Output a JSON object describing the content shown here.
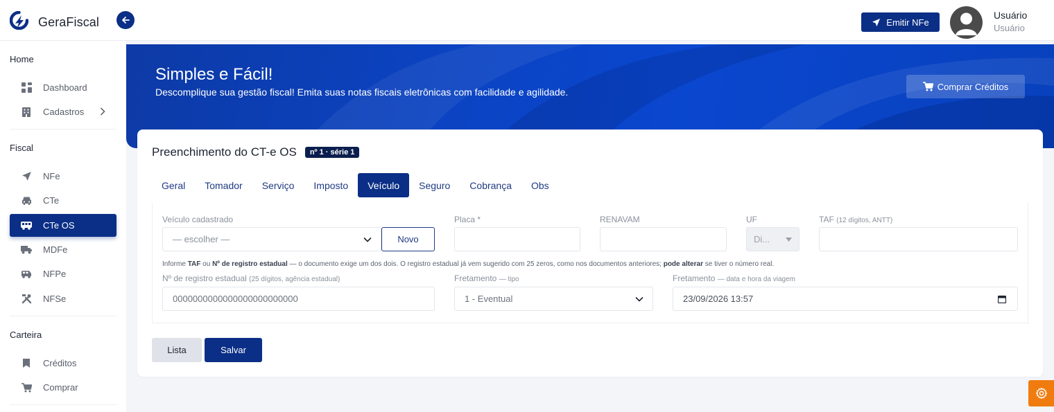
{
  "app": {
    "name": "GeraFiscal"
  },
  "header": {
    "emit_label": "Emitir NFe",
    "user_name": "Usuário",
    "user_role": "Usuário"
  },
  "sidebar": {
    "sections": [
      {
        "title": "Home",
        "items": [
          {
            "label": "Dashboard",
            "icon": "dashboard-icon"
          },
          {
            "label": "Cadastros",
            "icon": "building-icon"
          }
        ]
      },
      {
        "title": "Fiscal",
        "items": [
          {
            "label": "NFe",
            "icon": "send-icon"
          },
          {
            "label": "CTe",
            "icon": "car-icon"
          },
          {
            "label": "CTe OS",
            "icon": "bus-icon"
          },
          {
            "label": "MDFe",
            "icon": "truck-icon"
          },
          {
            "label": "NFPe",
            "icon": "van-icon"
          },
          {
            "label": "NFSe",
            "icon": "tools-icon"
          }
        ]
      },
      {
        "title": "Carteira",
        "items": [
          {
            "label": "Créditos",
            "icon": "bookmark-icon"
          },
          {
            "label": "Comprar",
            "icon": "cart-icon"
          }
        ]
      }
    ],
    "active": "CTe OS"
  },
  "hero": {
    "title": "Simples e Fácil!",
    "subtitle": "Descomplique sua gestão fiscal! Emita suas notas fiscais eletrônicas com facilidade e agilidade.",
    "buy_label": "Comprar Créditos"
  },
  "form": {
    "title": "Preenchimento do CT-e OS",
    "badge": "nº 1 · série 1",
    "tabs": [
      "Geral",
      "Tomador",
      "Serviço",
      "Imposto",
      "Veículo",
      "Seguro",
      "Cobrança",
      "Obs"
    ],
    "active_tab": "Veículo",
    "fields": {
      "veiculo_label": "Veículo cadastrado",
      "veiculo_value": "— escolher —",
      "novo_label": "Novo",
      "placa_label": "Placa *",
      "renavam_label": "RENAVAM",
      "uf_label": "UF",
      "uf_value": "Di...",
      "taf_label": "TAF",
      "taf_note": "(12 dígitos, ANTT)",
      "registro_label": "Nº de registro estadual",
      "registro_note": "(25 dígitos, agência estadual)",
      "registro_value": "0000000000000000000000000",
      "fretamento_tipo_label": "Fretamento",
      "fretamento_tipo_note": "— tipo",
      "fretamento_tipo_value": "1 - Eventual",
      "fretamento_data_label": "Fretamento",
      "fretamento_data_note": "— data e hora da viagem",
      "fretamento_data_value": "23/09/2026 13:57"
    },
    "hint": {
      "p1": "Informe ",
      "b1": "TAF",
      "p2": " ou ",
      "b2": "Nº de registro estadual",
      "p3": " — o documento exige um dos dois. O registro estadual já vem sugerido com 25 zeros, como nos documentos anteriores; ",
      "b3": "pode alterar",
      "p4": " se tiver o número real."
    },
    "buttons": {
      "lista": "Lista",
      "salvar": "Salvar"
    }
  },
  "colors": {
    "primary": "#0b2f86",
    "hero": "#0b43c2",
    "accent": "#f07c10"
  }
}
